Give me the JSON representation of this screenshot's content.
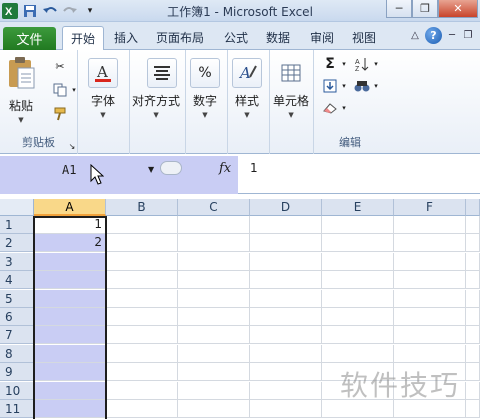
{
  "window": {
    "title": "工作簿1 - Microsoft Excel",
    "controls": [
      "minimize",
      "restore",
      "close"
    ]
  },
  "ribbon_tabs": {
    "file": "文件",
    "tabs": [
      "开始",
      "插入",
      "页面布局",
      "公式",
      "数据",
      "审阅",
      "视图"
    ],
    "active": "开始"
  },
  "ribbon": {
    "clipboard": {
      "paste_label": "粘贴",
      "group_label": "剪贴板"
    },
    "font_label": "字体",
    "alignment_label": "对齐方式",
    "number_label": "数字",
    "number_icon": "%",
    "styles_label": "样式",
    "cells_label": "单元格",
    "editing_group_label": "编辑"
  },
  "formula_bar": {
    "name_box": "A1",
    "fx": "fx",
    "content": "1"
  },
  "sheet": {
    "columns": [
      "A",
      "B",
      "C",
      "D",
      "E",
      "F"
    ],
    "rows": [
      "1",
      "2",
      "3",
      "4",
      "5",
      "6",
      "7",
      "8",
      "9",
      "10",
      "11"
    ],
    "selected_column": "A",
    "active_cell": "A1",
    "cells": {
      "A1": "1",
      "A2": "2"
    }
  },
  "watermark": "软件技巧",
  "colors": {
    "file_tab": "#2e8b2e",
    "selection": "#c9cdf4",
    "header_highlight": "#f9d889"
  }
}
